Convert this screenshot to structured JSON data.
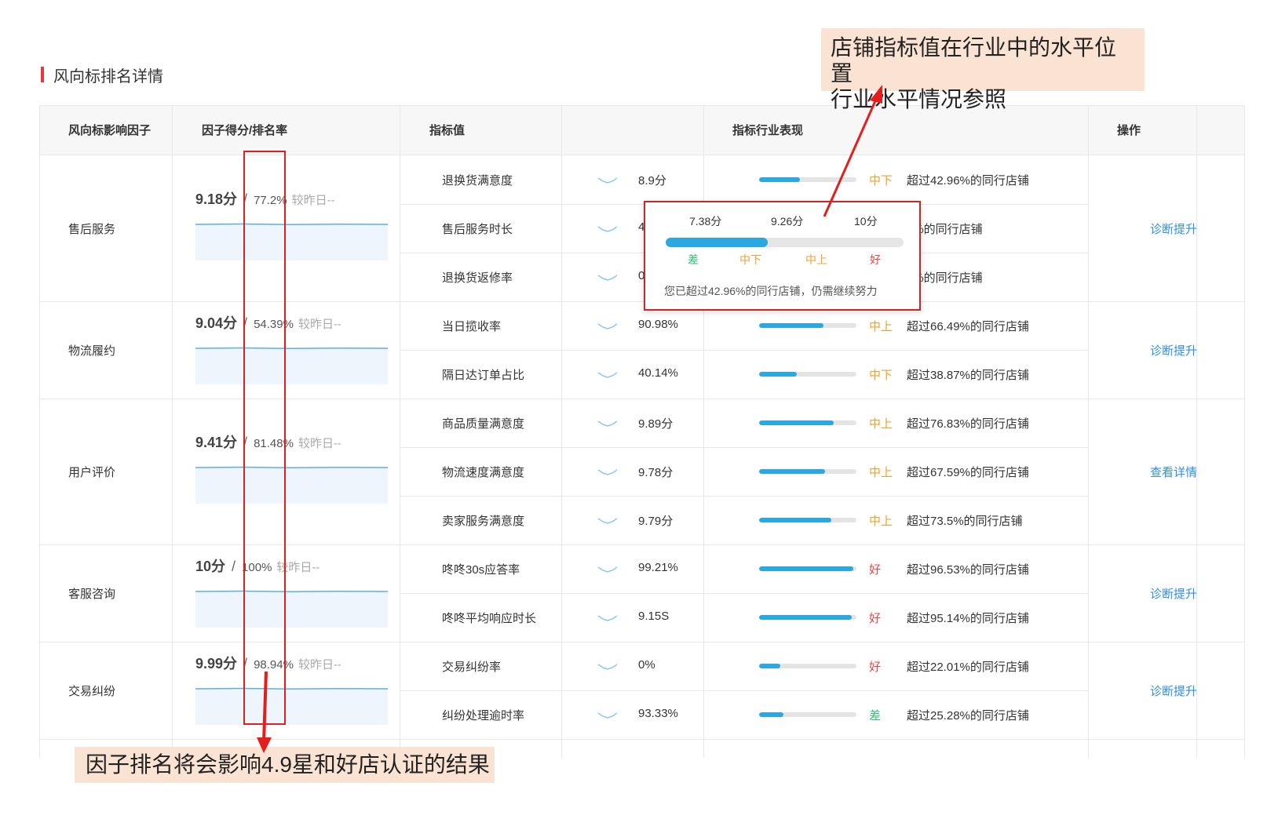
{
  "section_title": "风向标排名详情",
  "headers": {
    "factor": "风向标影响因子",
    "score_rank": "因子得分/排名率",
    "indicator": "指标值",
    "industry": "指标行业表现",
    "operation": "操作"
  },
  "colors": {
    "accent_red": "#e4393c",
    "bar_blue": "#2ba7e2",
    "link_blue": "#2e8ff0",
    "level_orange": "#f0a030",
    "level_red": "#f04545",
    "level_green": "#2fbf71",
    "note_bg": "#fbe3d3"
  },
  "factors": [
    {
      "name": "售后服务",
      "score": "9.18分",
      "rank": "77.2%",
      "compare": "较昨日--",
      "action": "诊断提升",
      "indicators": [
        {
          "name": "退换货满意度",
          "value": "8.9分",
          "level": "中下",
          "level_type": "mid-low",
          "progress": 0.42,
          "exceed": "超过42.96%的同行店铺"
        },
        {
          "name": "售后服务时长",
          "value": "4.9H",
          "level": "",
          "level_type": "",
          "progress": 0.42,
          "exceed": "2%的同行店铺"
        },
        {
          "name": "退换货返修率",
          "value": "0%",
          "level": "",
          "level_type": "",
          "progress": 0.42,
          "exceed": "6%的同行店铺"
        }
      ]
    },
    {
      "name": "物流履约",
      "score": "9.04分",
      "rank": "54.39%",
      "compare": "较昨日--",
      "action": "诊断提升",
      "indicators": [
        {
          "name": "当日揽收率",
          "value": "90.98%",
          "level": "中上",
          "level_type": "mid-high",
          "progress": 0.66,
          "exceed": "超过66.49%的同行店铺"
        },
        {
          "name": "隔日达订单占比",
          "value": "40.14%",
          "level": "中下",
          "level_type": "mid-low",
          "progress": 0.39,
          "exceed": "超过38.87%的同行店铺"
        }
      ]
    },
    {
      "name": "用户评价",
      "score": "9.41分",
      "rank": "81.48%",
      "compare": "较昨日--",
      "action": "查看详情",
      "indicators": [
        {
          "name": "商品质量满意度",
          "value": "9.89分",
          "level": "中上",
          "level_type": "mid-high",
          "progress": 0.77,
          "exceed": "超过76.83%的同行店铺"
        },
        {
          "name": "物流速度满意度",
          "value": "9.78分",
          "level": "中上",
          "level_type": "mid-high",
          "progress": 0.68,
          "exceed": "超过67.59%的同行店铺"
        },
        {
          "name": "卖家服务满意度",
          "value": "9.79分",
          "level": "中上",
          "level_type": "mid-high",
          "progress": 0.74,
          "exceed": "超过73.5%的同行店铺"
        }
      ]
    },
    {
      "name": "客服咨询",
      "score": "10分",
      "rank": "100%",
      "compare": "较昨日--",
      "action": "诊断提升",
      "indicators": [
        {
          "name": "咚咚30s应答率",
          "value": "99.21%",
          "level": "好",
          "level_type": "good",
          "progress": 0.97,
          "exceed": "超过96.53%的同行店铺"
        },
        {
          "name": "咚咚平均响应时长",
          "value": "9.15S",
          "level": "好",
          "level_type": "good",
          "progress": 0.95,
          "exceed": "超过95.14%的同行店铺"
        }
      ]
    },
    {
      "name": "交易纠纷",
      "score": "9.99分",
      "rank": "98.94%",
      "compare": "较昨日--",
      "action": "诊断提升",
      "indicators": [
        {
          "name": "交易纠纷率",
          "value": "0%",
          "level": "好",
          "level_type": "good",
          "progress": 0.22,
          "exceed": "超过22.01%的同行店铺"
        },
        {
          "name": "纠纷处理逾时率",
          "value": "93.33%",
          "level": "差",
          "level_type": "poor",
          "progress": 0.25,
          "exceed": "超过25.28%的同行店铺"
        }
      ]
    }
  ],
  "popup": {
    "ticks": [
      "7.38分",
      "9.26分",
      "10分"
    ],
    "levels": [
      "差",
      "中下",
      "中上",
      "好"
    ],
    "progress": 0.43,
    "desc": "您已超过42.96%的同行店铺，仍需继续努力"
  },
  "annotations": {
    "top_note_line1": "店铺指标值在行业中的水平位置",
    "top_note_line2": "行业水平情况参照",
    "bottom_note": "因子排名将会影响4.9星和好店认证的结果"
  }
}
